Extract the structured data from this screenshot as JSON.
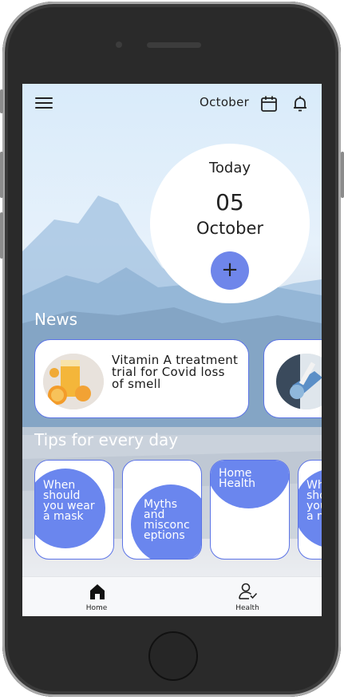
{
  "topbar": {
    "menu_icon": "hamburger-menu-icon",
    "month": "October",
    "calendar_icon": "calendar-icon",
    "bell_icon": "bell-icon"
  },
  "today": {
    "label": "Today",
    "day": "05",
    "month": "October",
    "add_label": "+"
  },
  "news": {
    "title": "News",
    "items": [
      {
        "title": "Vitamin A treatment trial for Covid loss of smell",
        "thumbnail": "orange-juice-image"
      },
      {
        "title": "",
        "thumbnail": "lab-test-image"
      }
    ]
  },
  "tips": {
    "title": "Tips for every day",
    "items": [
      {
        "label": "When should you wear a mask"
      },
      {
        "label": "Myths and misconc eptions"
      },
      {
        "label": "Home Health"
      },
      {
        "label": "When should you wear a mask"
      }
    ]
  },
  "bottom_nav": {
    "items": [
      {
        "label": "Home",
        "icon": "home-icon"
      },
      {
        "label": "Health",
        "icon": "person-check-icon"
      }
    ]
  },
  "colors": {
    "accent": "#6f86ea",
    "card_border": "#5c74e6",
    "text": "#222222"
  }
}
